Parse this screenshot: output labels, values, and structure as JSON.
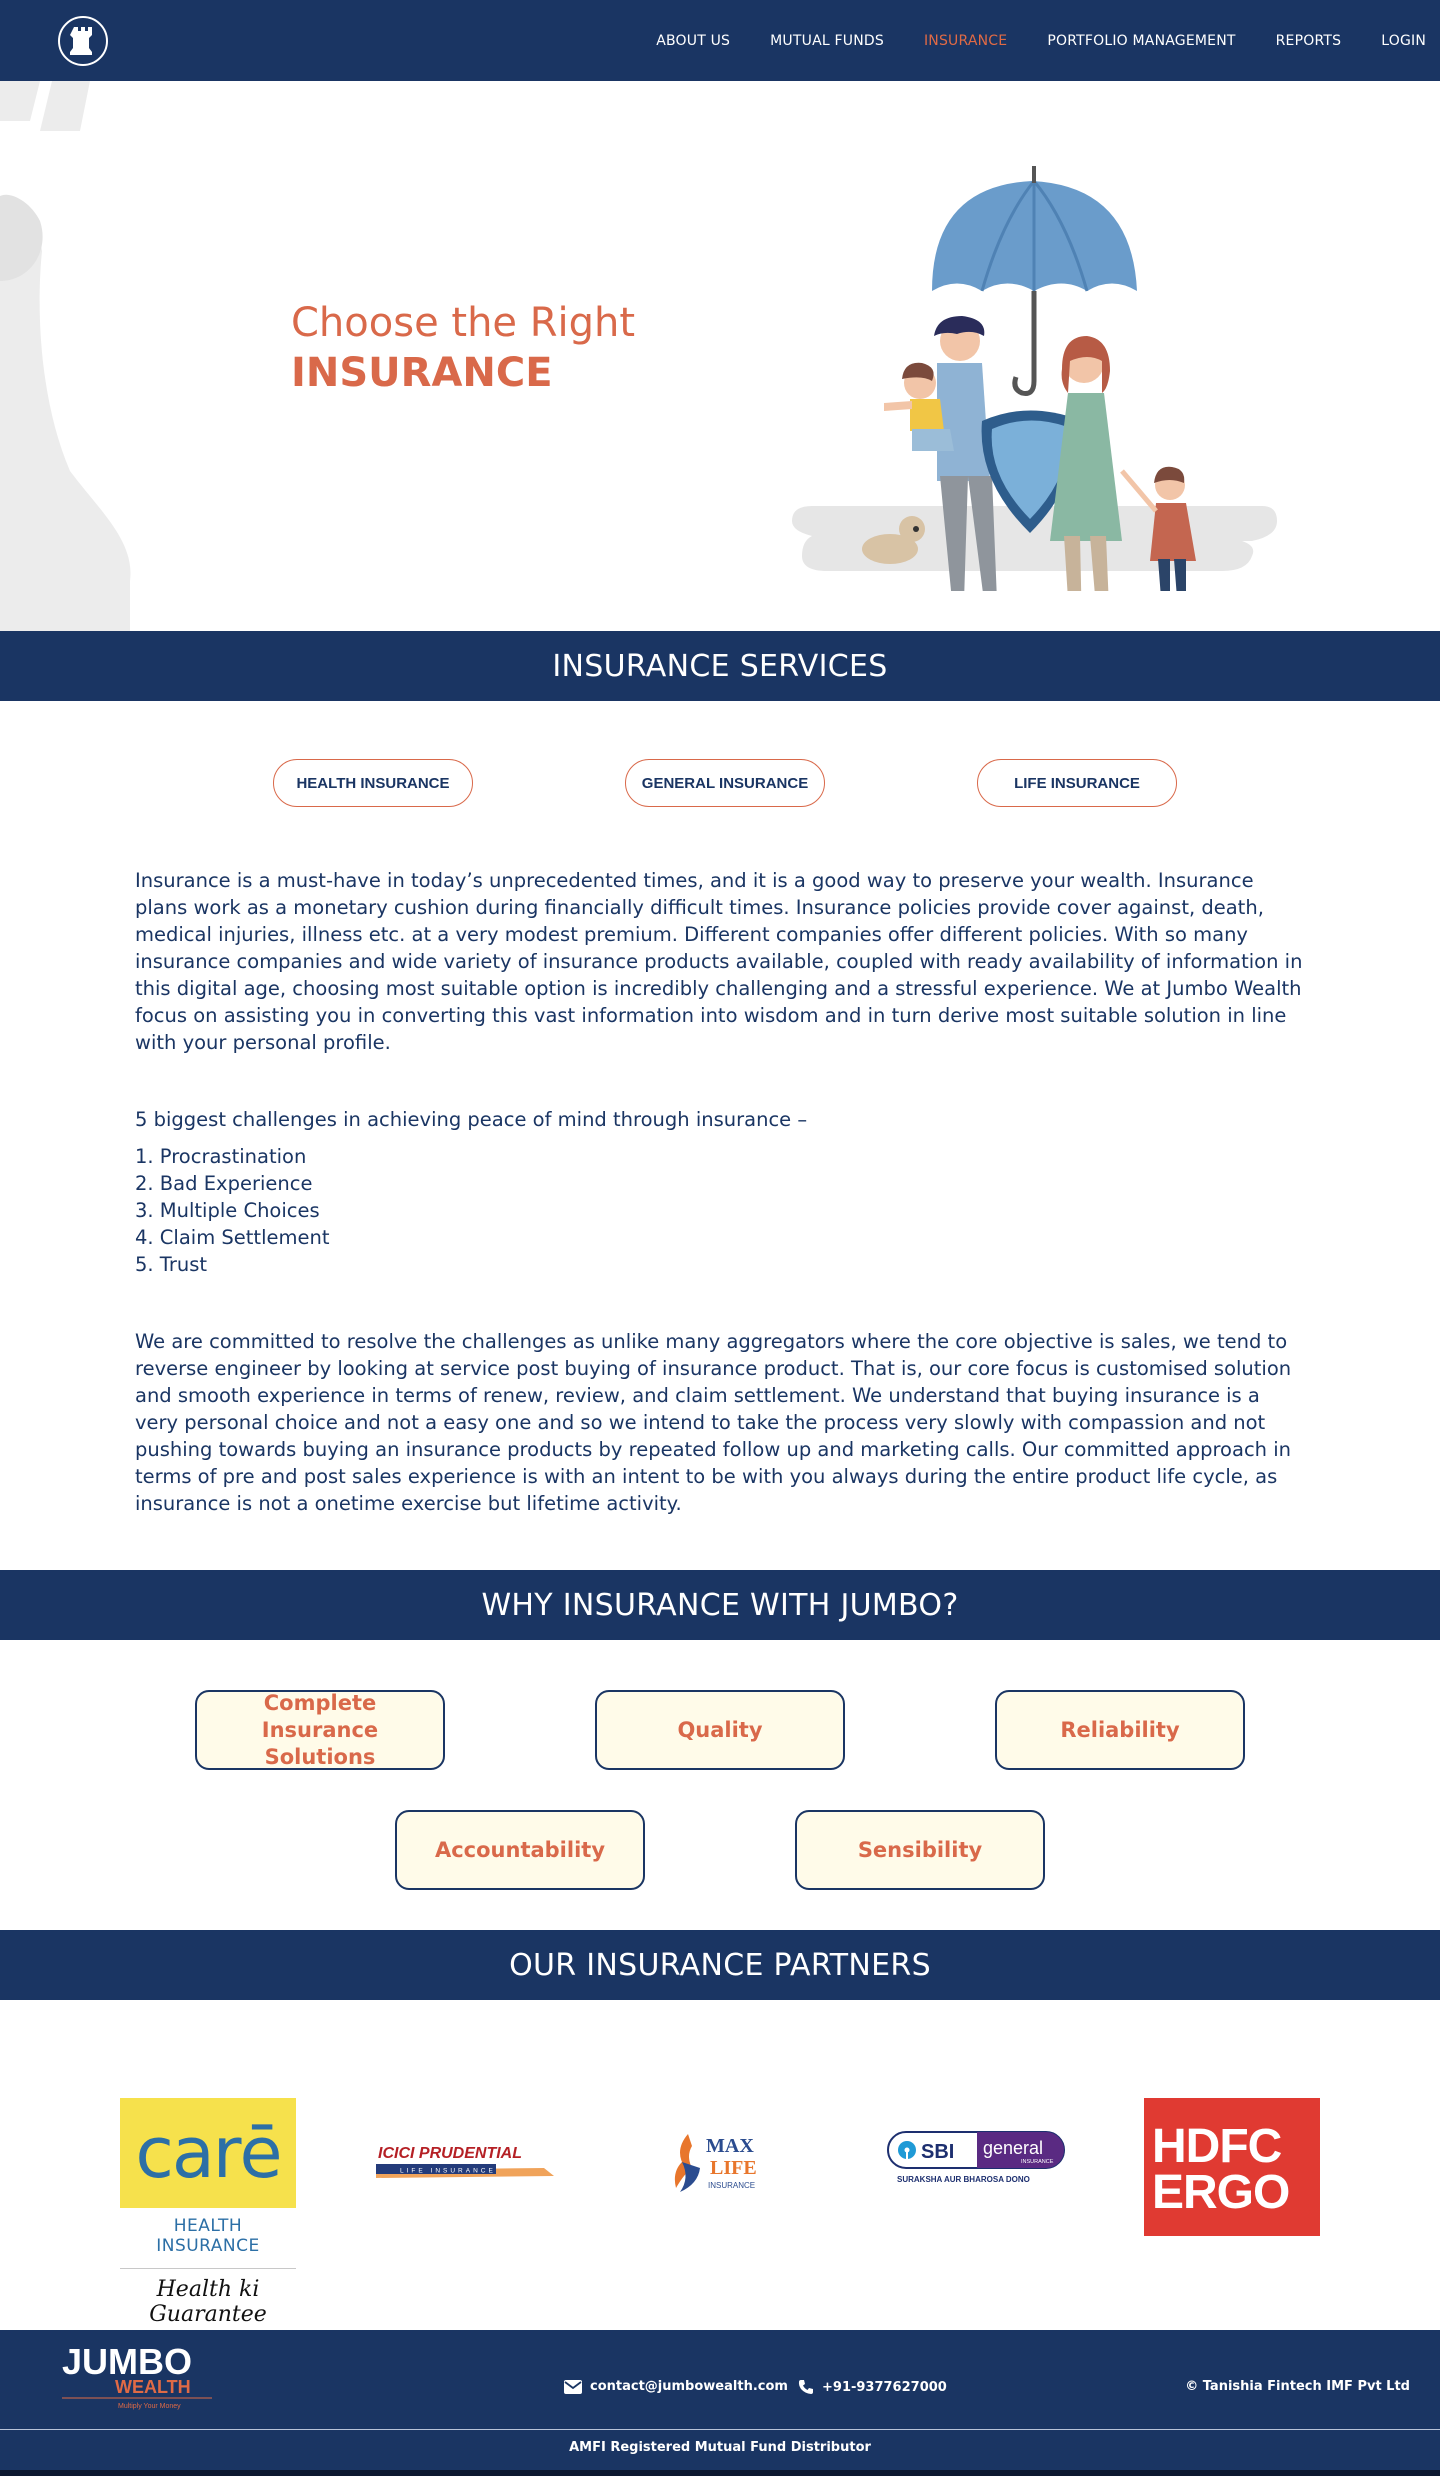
{
  "nav": {
    "logo_icon": "chess-rook-icon",
    "items": [
      {
        "label": "ABOUT US",
        "active": false
      },
      {
        "label": "MUTUAL FUNDS",
        "active": false
      },
      {
        "label": "INSURANCE",
        "active": true
      },
      {
        "label": "PORTFOLIO MANAGEMENT",
        "active": false
      },
      {
        "label": "REPORTS",
        "active": false
      },
      {
        "label": "LOGIN",
        "active": false
      }
    ]
  },
  "hero": {
    "line1": "Choose the Right",
    "line2": "INSURANCE"
  },
  "services": {
    "heading": "INSURANCE SERVICES",
    "pills": [
      "HEALTH INSURANCE",
      "GENERAL INSURANCE",
      "LIFE INSURANCE"
    ],
    "intro": "Insurance is a must-have in today’s unprecedented times, and it is a good way to preserve your wealth. Insurance plans work as a monetary cushion during financially difficult times. Insurance policies provide cover against, death, medical injuries, illness etc. at a very modest premium. Different companies offer different policies. With so many insurance companies and wide variety of insurance products available, coupled with ready availability of information in this digital age, choosing most suitable option is incredibly challenging and a stressful experience. We at Jumbo Wealth focus on assisting you in converting this vast information into wisdom and in turn derive most suitable solution in line with your personal profile.",
    "challenges_intro": "5 biggest challenges in achieving peace of mind through insurance –",
    "challenges": [
      "1. Procrastination",
      "2. Bad Experience",
      "3. Multiple Choices",
      "4. Claim Settlement",
      "5. Trust"
    ],
    "commitment": "We are committed to resolve the challenges as unlike many aggregators where the core objective is sales, we tend to reverse engineer by looking at service post buying of insurance product. That is, our core focus is customised solution and smooth experience in terms of renew, review, and claim settlement. We understand that buying insurance is a very personal choice and not a easy one and so we intend to take the process very slowly with compassion and not pushing towards buying an insurance products by repeated follow up and marketing calls. Our committed approach in terms of pre and post sales experience is with an intent to be with you always during the entire product life cycle, as insurance is not a onetime exercise but lifetime activity."
  },
  "why": {
    "heading": "WHY INSURANCE WITH JUMBO?",
    "row1": [
      "Complete Insurance Solutions",
      "Quality",
      "Reliability"
    ],
    "row2": [
      "Accountability",
      "Sensibility"
    ]
  },
  "partners": {
    "heading": "OUR INSURANCE PARTNERS",
    "care": {
      "name": "carē",
      "sub": "HEALTH INSURANCE",
      "tagline": "Health ki Guarantee"
    },
    "icici": {
      "name": "ICICI PRUDENTIAL",
      "sub": "LIFE INSURANCE"
    },
    "max": {
      "line1": "MAX",
      "line2": "LIFE",
      "line3": "INSURANCE"
    },
    "sbi": {
      "brand": "SBI",
      "word": "general",
      "small": "INSURANCE",
      "tagline": "SURAKSHA AUR BHAROSA DONO"
    },
    "hdfc": {
      "line1": "HDFC",
      "line2": "ERGO"
    }
  },
  "footer": {
    "logo_line1": "JUMBO",
    "logo_line2": "WEALTH",
    "logo_tagline": "Multiply Your Money",
    "email": "contact@jumbowealth.com",
    "phone": "+91-9377627000",
    "copyright": "© Tanishia Fintech IMF Pvt Ltd",
    "amfi": "AMFI Registered Mutual Fund Distributor"
  },
  "colors": {
    "navy": "#1a3563",
    "accent": "#d9694a",
    "box_bg": "#fffbe9"
  }
}
